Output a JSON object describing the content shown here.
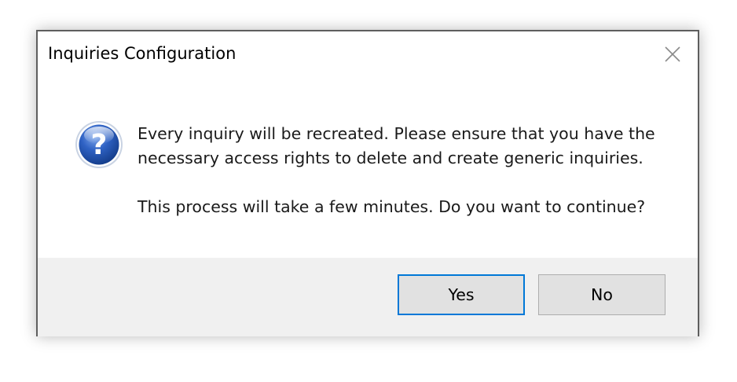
{
  "dialog": {
    "title": "Inquiries Configuration",
    "close_icon": "close-icon",
    "icon": "question-icon",
    "message_line1": "Every inquiry will be recreated. Please ensure that you have the necessary access rights to delete and create generic inquiries.",
    "message_line2": "This process will take a few minutes. Do you want to continue?",
    "buttons": {
      "yes_label": "Yes",
      "no_label": "No"
    }
  },
  "colors": {
    "footer_bg": "#f0f0f0",
    "border": "#5e5e5e",
    "icon_blue": "#1e4fa8"
  }
}
